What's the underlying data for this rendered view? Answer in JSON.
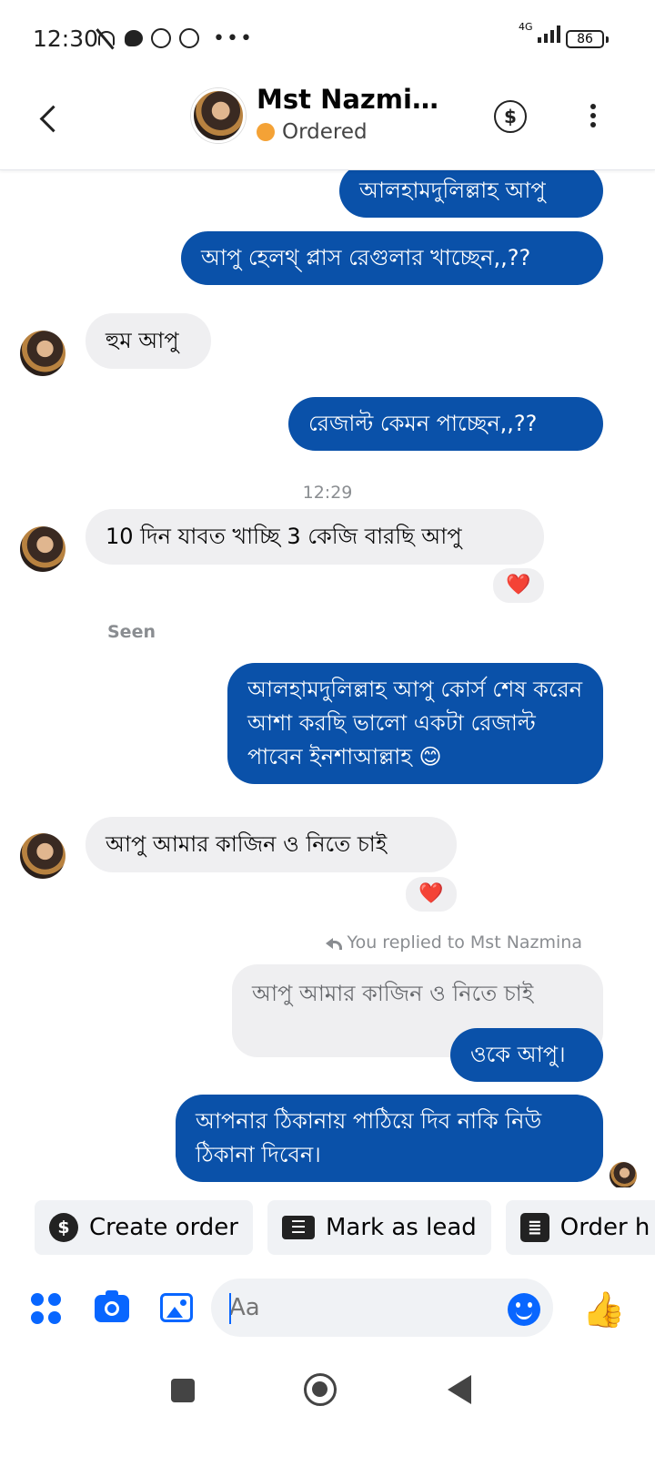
{
  "status_bar": {
    "time": "12:30",
    "network": "4G",
    "battery": "86"
  },
  "header": {
    "contact_name": "Mst Nazmin...",
    "status_label": "Ordered",
    "status_color": "#f4a236"
  },
  "messages": {
    "out_1": "আলহামদুলিল্লাহ আপু",
    "out_2": "আপু হেলথ্ প্লাস রেগুলার খাচ্ছেন,,??",
    "in_1": "হুম আপু",
    "out_3": "রেজাল্ট কেমন পাচ্ছেন,,??",
    "timestamp": "12:29",
    "in_2": "10 দিন যাবত খাচ্ছি 3 কেজি বারছি আপু",
    "in_2_reaction": "❤️",
    "seen": "Seen",
    "out_4": "আলহামদুলিল্লাহ আপু কোর্স শেষ করেন আশা করছি ভালো একটা রেজাল্ট পাবেন ইনশাআল্লাহ 😊",
    "in_3": "আপু আমার কাজিন ও নিতে চাই",
    "in_3_reaction": "❤️",
    "reply_note": "You replied to Mst Nazmina",
    "quoted_text": "আপু আমার কাজিন ও নিতে চাই",
    "out_5": "ওকে আপু।",
    "out_6": "আপনার ঠিকানায় পাঠিয়ে দিব নাকি নিউ ঠিকানা দিবেন।"
  },
  "quick_actions": [
    {
      "label": "Create order",
      "icon": "dollar-icon"
    },
    {
      "label": "Mark as lead",
      "icon": "contact-card-icon"
    },
    {
      "label": "Order h",
      "icon": "order-list-icon"
    }
  ],
  "composer": {
    "placeholder": "Aa"
  },
  "colors": {
    "outgoing_bubble": "#0a51a9",
    "incoming_bubble": "#efeff1",
    "accent": "#0866ff"
  }
}
